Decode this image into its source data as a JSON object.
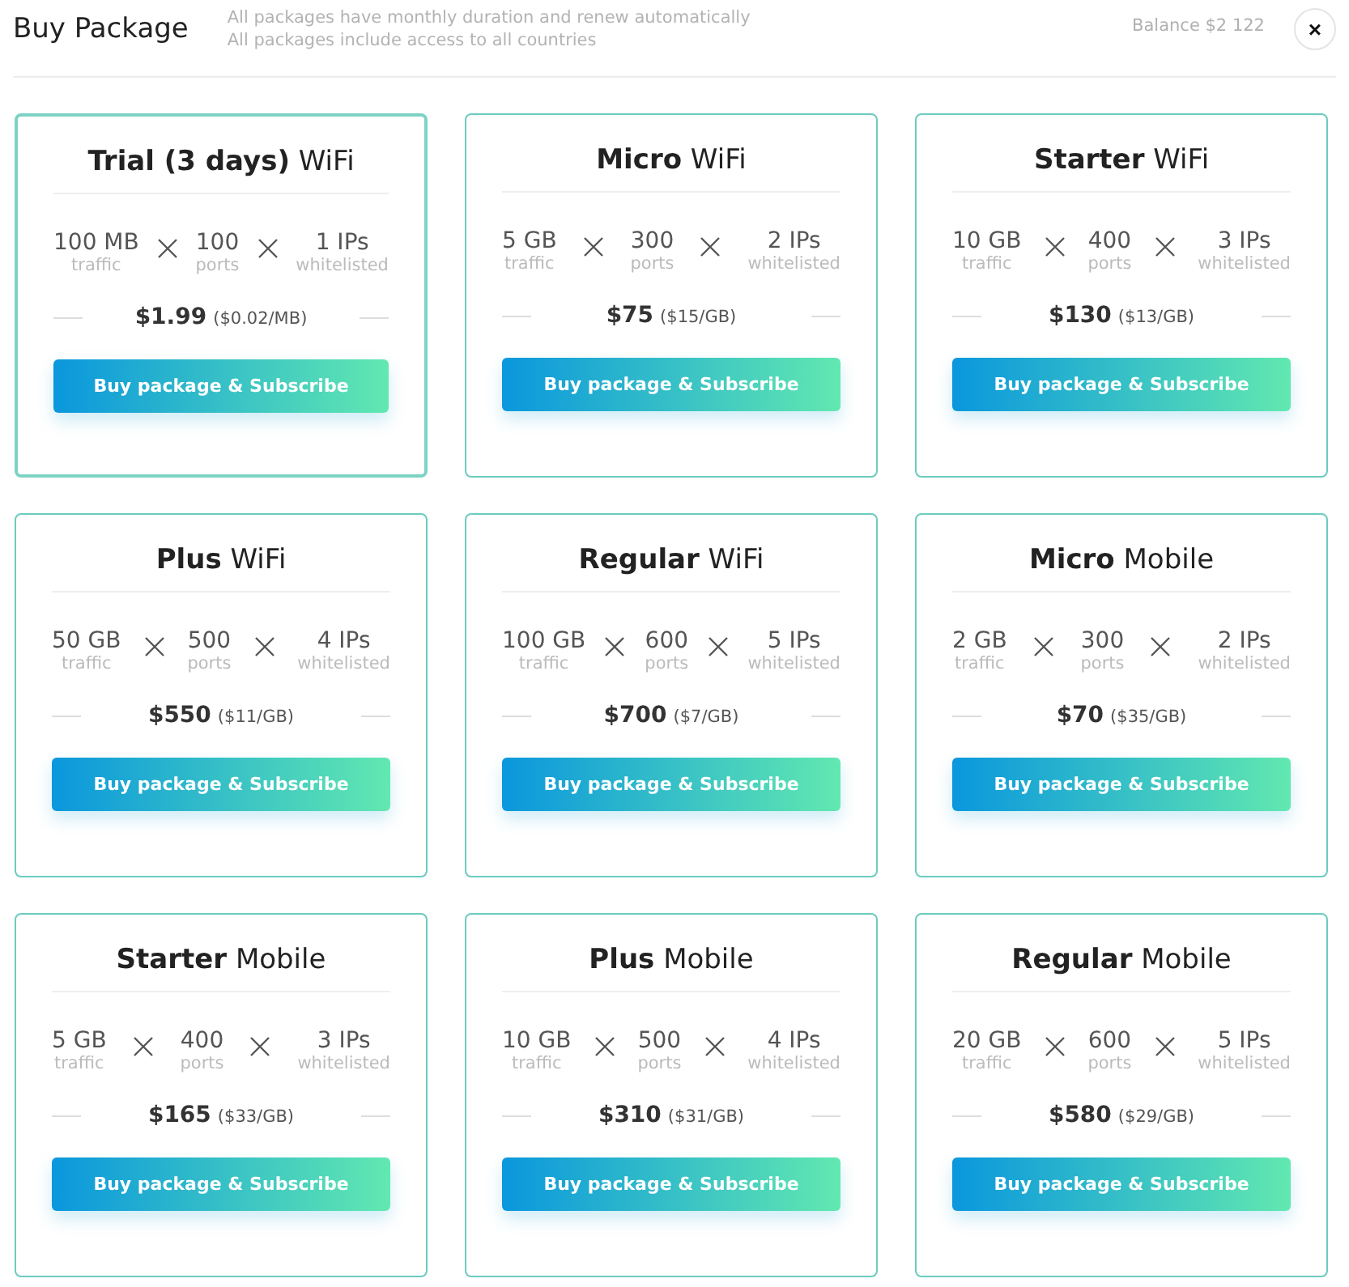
{
  "title": "Buy Package",
  "notes": [
    "All packages have monthly duration and renew automatically",
    "All packages include access to all countries"
  ],
  "balance": "Balance $2 122",
  "close": "×",
  "packages": [
    {
      "title": "**Trial (3 days)** WiFi",
      "selected": true,
      "specs": [
        {
          "value": "100 MB",
          "label": "traffic"
        },
        {
          "value": "100",
          "label": "ports"
        },
        {
          "value": "1 IPs",
          "label": "whitelisted"
        }
      ],
      "price": "$1.99",
      "unit_price": "($0.02/MB)",
      "button": "Buy package & Subscribe"
    },
    {
      "title": "**Micro** WiFi",
      "selected": false,
      "specs": [
        {
          "value": "5 GB",
          "label": "traffic"
        },
        {
          "value": "300",
          "label": "ports"
        },
        {
          "value": "2 IPs",
          "label": "whitelisted"
        }
      ],
      "price": "$75",
      "unit_price": "($15/GB)",
      "button": "Buy package & Subscribe"
    },
    {
      "title": "**Starter** WiFi",
      "selected": false,
      "specs": [
        {
          "value": "10 GB",
          "label": "traffic"
        },
        {
          "value": "400",
          "label": "ports"
        },
        {
          "value": "3 IPs",
          "label": "whitelisted"
        }
      ],
      "price": "$130",
      "unit_price": "($13/GB)",
      "button": "Buy package & Subscribe"
    },
    {
      "title": "**Plus** WiFi",
      "selected": false,
      "specs": [
        {
          "value": "50 GB",
          "label": "traffic"
        },
        {
          "value": "500",
          "label": "ports"
        },
        {
          "value": "4 IPs",
          "label": "whitelisted"
        }
      ],
      "price": "$550",
      "unit_price": "($11/GB)",
      "button": "Buy package & Subscribe"
    },
    {
      "title": "**Regular** WiFi",
      "selected": false,
      "specs": [
        {
          "value": "100 GB",
          "label": "traffic"
        },
        {
          "value": "600",
          "label": "ports"
        },
        {
          "value": "5 IPs",
          "label": "whitelisted"
        }
      ],
      "price": "$700",
      "unit_price": "($7/GB)",
      "button": "Buy package & Subscribe"
    },
    {
      "title": "**Micro** Mobile",
      "selected": false,
      "specs": [
        {
          "value": "2 GB",
          "label": "traffic"
        },
        {
          "value": "300",
          "label": "ports"
        },
        {
          "value": "2 IPs",
          "label": "whitelisted"
        }
      ],
      "price": "$70",
      "unit_price": "($35/GB)",
      "button": "Buy package & Subscribe"
    },
    {
      "title": "**Starter** Mobile",
      "selected": false,
      "specs": [
        {
          "value": "5 GB",
          "label": "traffic"
        },
        {
          "value": "400",
          "label": "ports"
        },
        {
          "value": "3 IPs",
          "label": "whitelisted"
        }
      ],
      "price": "$165",
      "unit_price": "($33/GB)",
      "button": "Buy package & Subscribe"
    },
    {
      "title": "**Plus** Mobile",
      "selected": false,
      "specs": [
        {
          "value": "10 GB",
          "label": "traffic"
        },
        {
          "value": "500",
          "label": "ports"
        },
        {
          "value": "4 IPs",
          "label": "whitelisted"
        }
      ],
      "price": "$310",
      "unit_price": "($31/GB)",
      "button": "Buy package & Subscribe"
    },
    {
      "title": "**Regular** Mobile",
      "selected": false,
      "specs": [
        {
          "value": "20 GB",
          "label": "traffic"
        },
        {
          "value": "600",
          "label": "ports"
        },
        {
          "value": "5 IPs",
          "label": "whitelisted"
        }
      ],
      "price": "$580",
      "unit_price": "($29/GB)",
      "button": "Buy package & Subscribe"
    }
  ]
}
